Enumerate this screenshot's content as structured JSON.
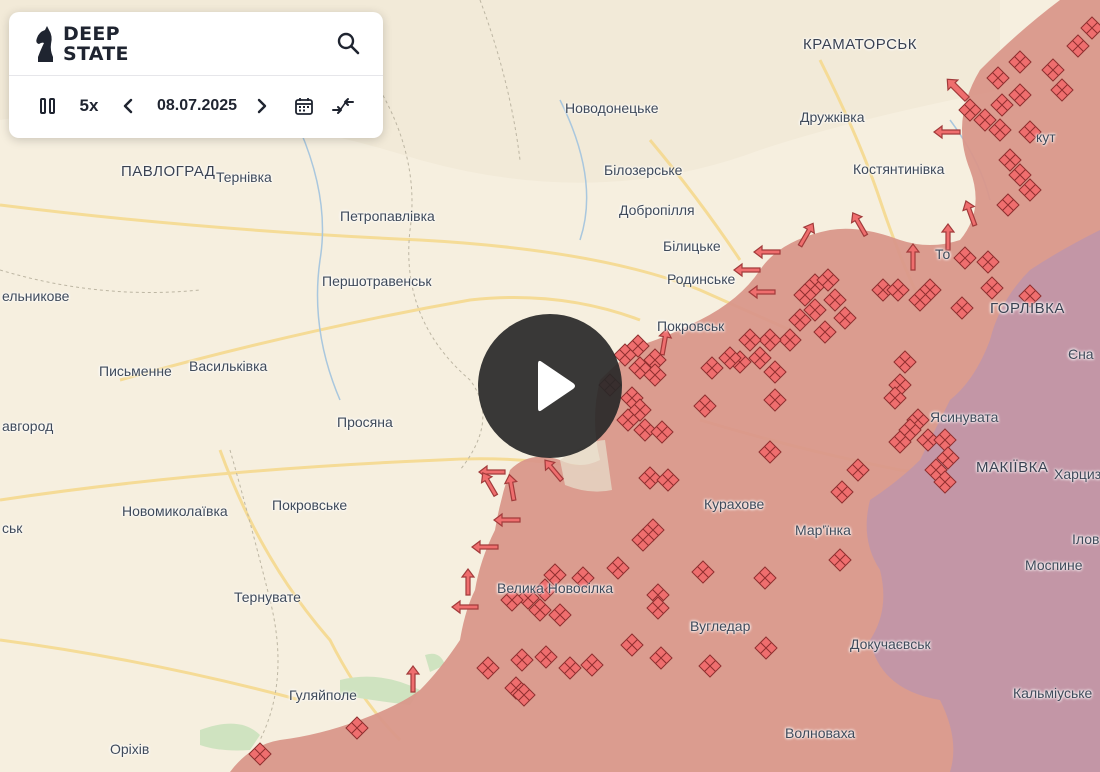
{
  "app": {
    "logo_line1": "DEEP",
    "logo_line2": "STATE"
  },
  "controls": {
    "speed": "5x",
    "date": "08.07.2025",
    "icons": [
      "pause-icon",
      "chevron-left-icon",
      "chevron-right-icon",
      "calendar-icon",
      "collapse-arrows-icon",
      "search-icon",
      "play-icon"
    ]
  },
  "colors": {
    "occupied": "#d9978a",
    "occupied_pre2022": "#c296a8",
    "land": "#f6efdf",
    "marker": "#ef6e6e"
  },
  "places": {
    "kramatorsk": "КРАМАТОРСЬК",
    "novodonetske": "Новодонецьке",
    "druzhkivka": "Дружківка",
    "pavlohrad": "ПАВЛОГРАД",
    "ternivka": "Тернівка",
    "bilozerske": "Білозерське",
    "kostiantynivka": "Костянтинівка",
    "petropavlivka": "Петропавлівка",
    "dobropillia": "Добропілля",
    "bilytske": "Білицьке",
    "rodynske": "Родинське",
    "pershotravensk": "Першотравенськ",
    "horlivka": "ГОРЛІВКА",
    "yelnykove": "ельникове",
    "pokrovsk": "Покровськ",
    "pysmenne": "Письменне",
    "vasylkivka": "Васильківка",
    "yasynuvata": "Ясинувата",
    "avhorod": "авгород",
    "prosiana": "Просяна",
    "makiivka": "МАКІЇВКА",
    "khartsyzk": "Харцизь",
    "kurakhove": "Курахове",
    "novomykolaivka": "Новомиколаївка",
    "pokrovske": "Покровське",
    "marinka": "Мар'їнка",
    "sk": "ськ",
    "ilov": "Ілов",
    "vnovosilka": "Велика Новосілка",
    "mospyne": "Моспине",
    "ternuvate": "Тернувате",
    "vuhledar": "Вугледар",
    "dokuchaievsk": "Докучаєвськ",
    "huliaipole": "Гуляйполе",
    "kalmiuske": "Кальміуське",
    "orikhiv": "Оріхів",
    "volnovakha": "Волноваха",
    "yen": "Єна",
    "tor": "То",
    "kut": "кут"
  }
}
